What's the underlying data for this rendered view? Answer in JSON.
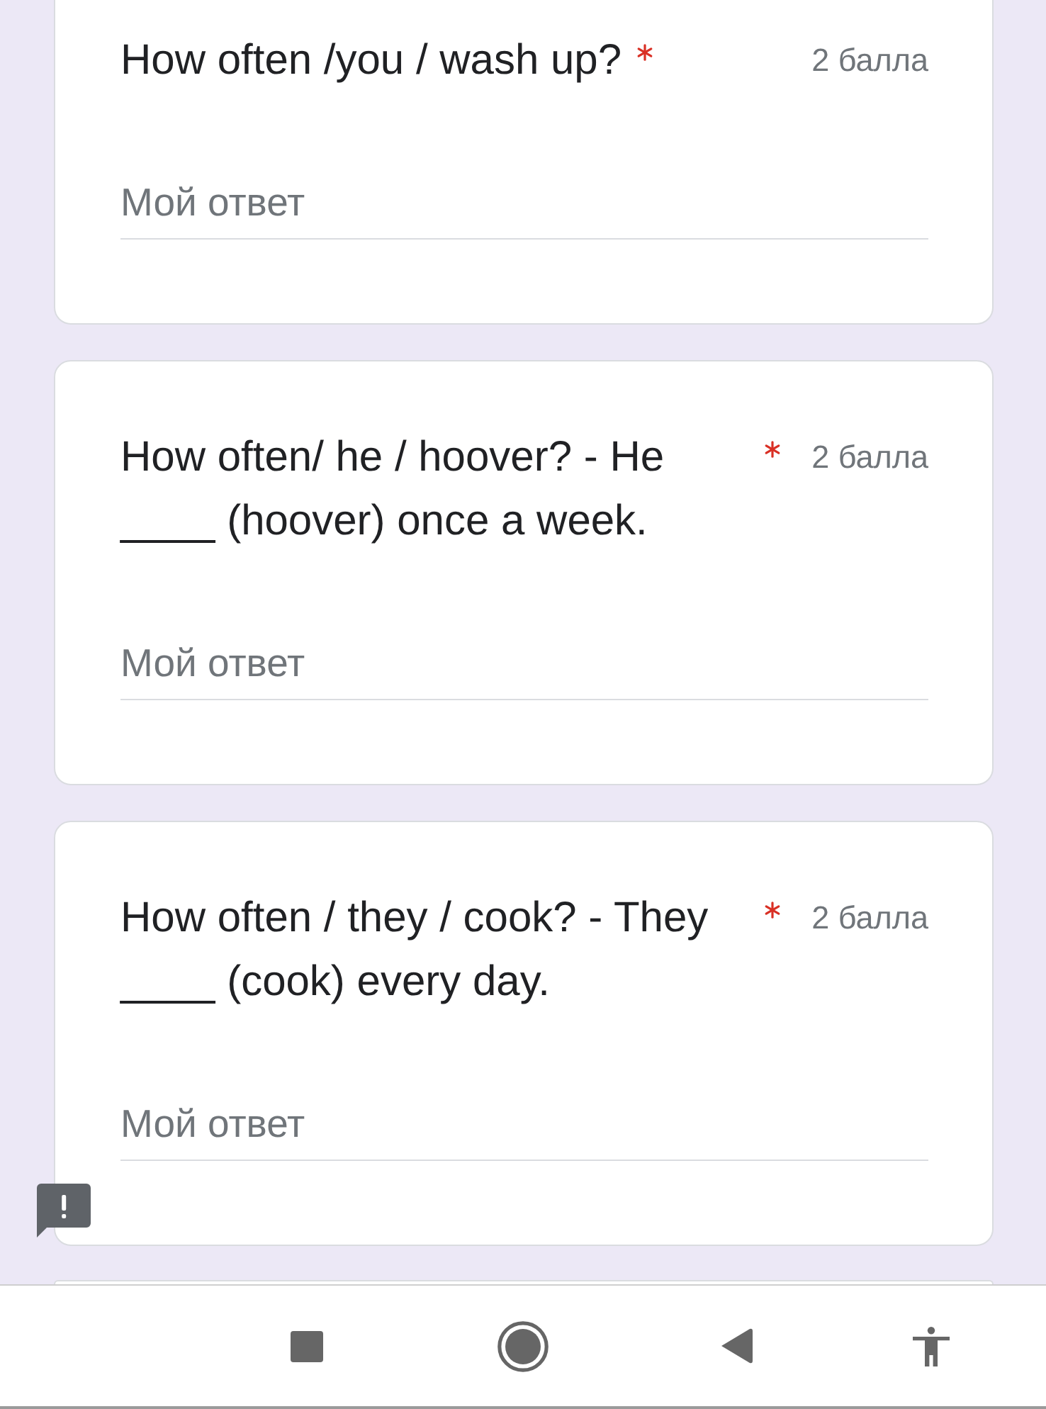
{
  "questions": [
    {
      "title": "How often /you / wash up?",
      "required": true,
      "points": "2 балла",
      "answer": {
        "placeholder": "Мой ответ"
      }
    },
    {
      "title": "How often/ he / hoover? - He ____ (hoover) once a week.",
      "required": true,
      "points": "2 балла",
      "answer": {
        "placeholder": "Мой ответ"
      }
    },
    {
      "title": "How often / they / cook? - They ____ (cook) every day.",
      "required": true,
      "points": "2 балла",
      "answer": {
        "placeholder": "Мой ответ"
      }
    }
  ]
}
